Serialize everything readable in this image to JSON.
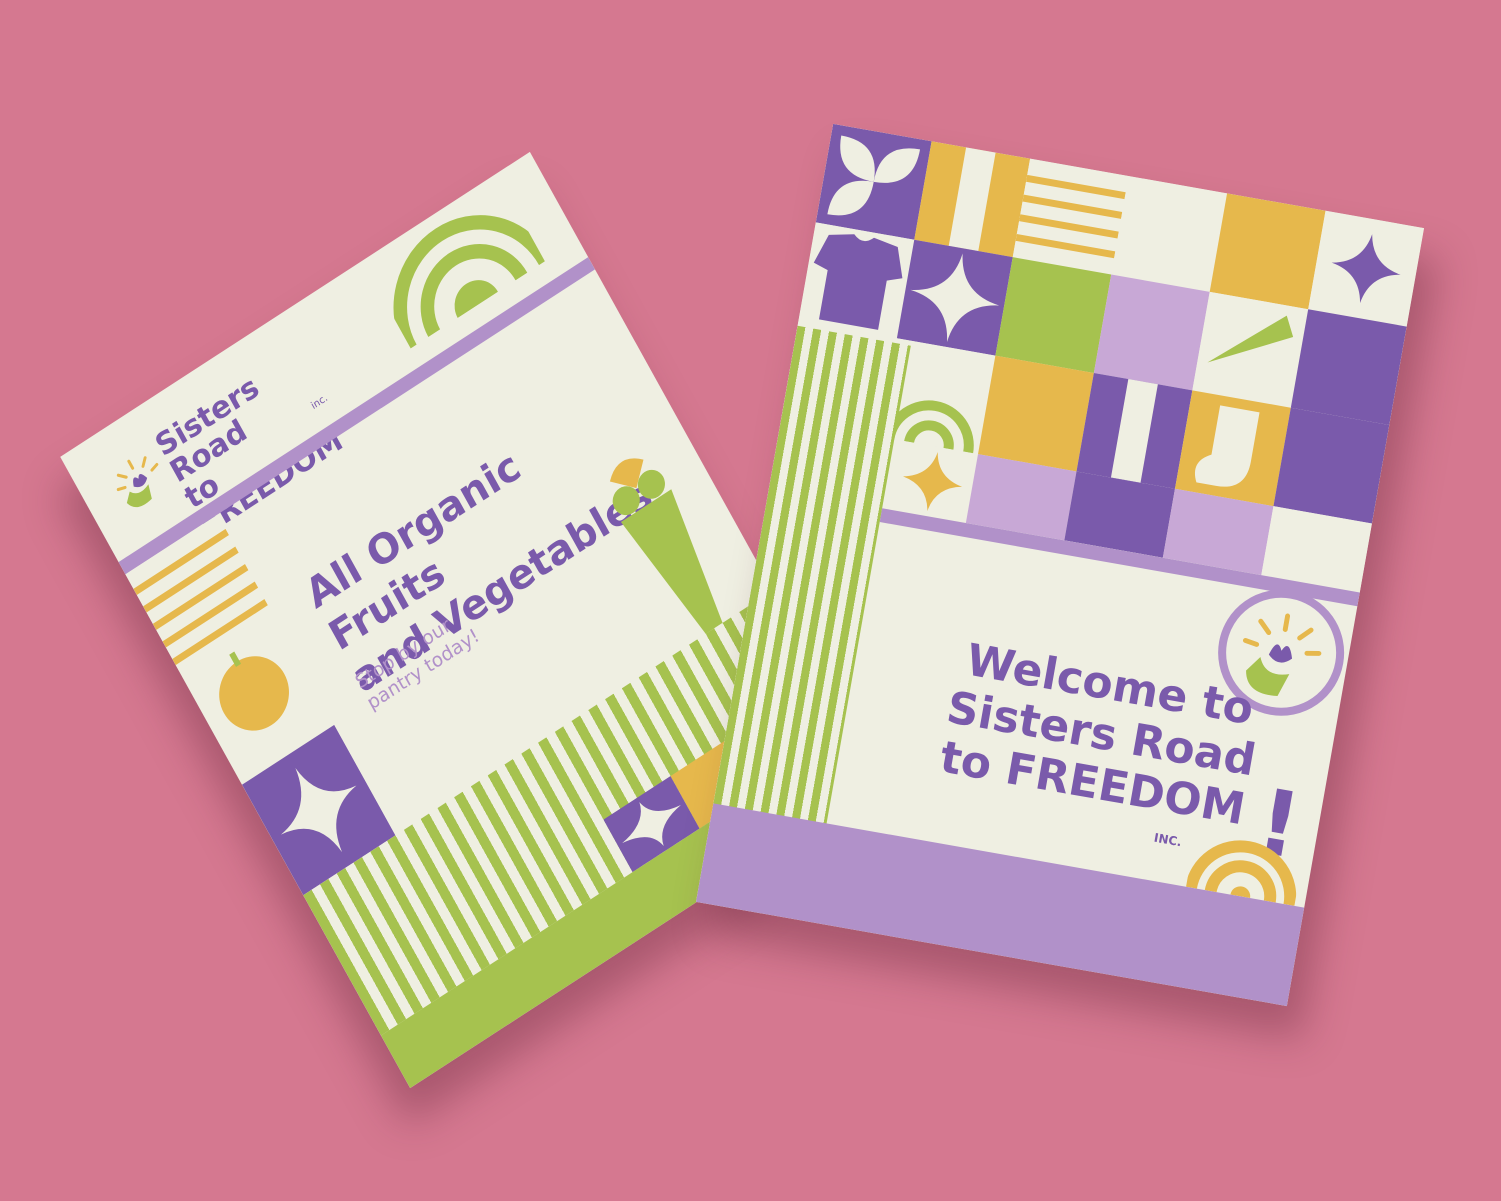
{
  "left_flyer": {
    "logo": {
      "line1": "Sisters Road",
      "line2": "to FREEDOM",
      "inc": "inc."
    },
    "headline_line1": "All Organic Fruits",
    "headline_line2": "and Vegetables",
    "subtext_line1": "Stop by our",
    "subtext_line2": "pantry today!"
  },
  "right_flyer": {
    "headline_line1": "Welcome to",
    "headline_line2": "Sisters Road",
    "headline_line3": "to FREEDOM",
    "exclamation": "!",
    "inc": "INC."
  },
  "colors": {
    "background": "#d57890",
    "paper": "#efefe2",
    "purple": "#7a5aab",
    "lavender": "#b191c9",
    "green": "#a6c24f",
    "yellow": "#e6b84c"
  },
  "icons": [
    "apple-icon",
    "carrot-icon",
    "sparkle-icon",
    "rainbow-arc-icon",
    "shirt-icon",
    "sock-icon",
    "leaf-icon",
    "flower-hand-icon"
  ]
}
